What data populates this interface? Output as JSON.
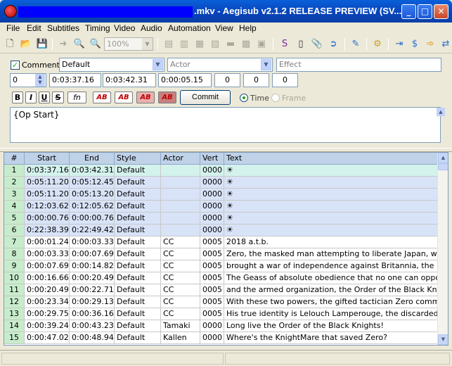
{
  "window": {
    "title": ".mkv - Aegisub v2.1.2 RELEASE PREVIEW (SV...",
    "minimize": "_",
    "maximize": "□",
    "close": "✕"
  },
  "menu": [
    "File",
    "Edit",
    "Subtitles",
    "Timing",
    "Video",
    "Audio",
    "Automation",
    "View",
    "Help"
  ],
  "toolbar": {
    "zoom": "100%",
    "icons": [
      "new-file-icon",
      "open-file-icon",
      "save-icon",
      "jump-icon",
      "zoom-in-icon",
      "zoom-out-icon",
      "zoom-select-icon",
      "clip-icon",
      "vector-clip-icon",
      "resample-icon",
      "styles-manager-icon",
      "attachments-icon",
      "find-icon",
      "replace-icon",
      "spell-check-icon",
      "properties-icon",
      "fonts-collector-icon",
      "translation-assistant-icon",
      "automation-icon",
      "timing-processor-icon",
      "kanji-timer-icon",
      "options-icon"
    ]
  },
  "editbox": {
    "comment_checked": true,
    "comment_label": "Comment",
    "style": "Default",
    "actor_placeholder": "Actor",
    "effect_placeholder": "Effect",
    "layer": "0",
    "start_time": "0:03:37.16",
    "end_time": "0:03:42.31",
    "duration": "0:00:05.15",
    "margin_l": "0",
    "margin_r": "0",
    "margin_v": "0",
    "bold": "B",
    "italic": "I",
    "underline": "U",
    "strikeout": "S",
    "font": "fn",
    "color1": "AB",
    "color2": "AB",
    "color3": "AB",
    "color4": "AB",
    "commit": "Commit",
    "time_label": "Time",
    "frame_label": "Frame",
    "time_mode": "Time",
    "text": "{Op Start}"
  },
  "grid": {
    "columns": [
      "#",
      "Start",
      "End",
      "Style",
      "Actor",
      "Vert",
      "Text"
    ],
    "rows": [
      {
        "n": "1",
        "start": "0:03:37.16",
        "end": "0:03:42.31",
        "style": "Default",
        "actor": "",
        "vert": "0000",
        "text": "☀",
        "state": "active"
      },
      {
        "n": "2",
        "start": "0:05:11.20",
        "end": "0:05:12.45",
        "style": "Default",
        "actor": "",
        "vert": "0000",
        "text": "☀",
        "state": "comment"
      },
      {
        "n": "3",
        "start": "0:05:11.20",
        "end": "0:05:13.20",
        "style": "Default",
        "actor": "",
        "vert": "0000",
        "text": "☀",
        "state": "comment"
      },
      {
        "n": "4",
        "start": "0:12:03.62",
        "end": "0:12:05.62",
        "style": "Default",
        "actor": "",
        "vert": "0000",
        "text": "☀",
        "state": "comment"
      },
      {
        "n": "5",
        "start": "0:00:00.76",
        "end": "0:00:00.76",
        "style": "Default",
        "actor": "",
        "vert": "0000",
        "text": "☀",
        "state": "comment"
      },
      {
        "n": "6",
        "start": "0:22:38.39",
        "end": "0:22:49.42",
        "style": "Default",
        "actor": "",
        "vert": "0000",
        "text": "☀",
        "state": "comment"
      },
      {
        "n": "7",
        "start": "0:00:01.24",
        "end": "0:00:03.33",
        "style": "Default",
        "actor": "CC",
        "vert": "0005",
        "text": "2018 a.t.b.",
        "state": "normal"
      },
      {
        "n": "8",
        "start": "0:00:03.33",
        "end": "0:00:07.69",
        "style": "Default",
        "actor": "CC",
        "vert": "0005",
        "text": "Zero, the masked man attempting to liberate Japan, which is n",
        "state": "normal"
      },
      {
        "n": "9",
        "start": "0:00:07.69",
        "end": "0:00:14.82",
        "style": "Default",
        "actor": "CC",
        "vert": "0005",
        "text": "brought a war of independence against Britannia, the Holy Em",
        "state": "normal"
      },
      {
        "n": "10",
        "start": "0:00:16.66",
        "end": "0:00:20.49",
        "style": "Default",
        "actor": "CC",
        "vert": "0005",
        "text": "The Geass of absolute obedience that no one can oppose,",
        "state": "normal"
      },
      {
        "n": "11",
        "start": "0:00:20.49",
        "end": "0:00:22.71",
        "style": "Default",
        "actor": "CC",
        "vert": "0005",
        "text": "and the armed organization, the Order of the Black Knights.",
        "state": "normal"
      },
      {
        "n": "12",
        "start": "0:00:23.34",
        "end": "0:00:29.13",
        "style": "Default",
        "actor": "CC",
        "vert": "0005",
        "text": "With these two powers, the gifted tactician Zero commences h",
        "state": "normal"
      },
      {
        "n": "13",
        "start": "0:00:29.75",
        "end": "0:00:36.16",
        "style": "Default",
        "actor": "CC",
        "vert": "0005",
        "text": "His true identity is Lelouch Lamperouge, the discarded prince c",
        "state": "normal"
      },
      {
        "n": "14",
        "start": "0:00:39.24",
        "end": "0:00:43.23",
        "style": "Default",
        "actor": "Tamaki",
        "vert": "0000",
        "text": "Long live the Order of the Black Knights!",
        "state": "normal"
      },
      {
        "n": "15",
        "start": "0:00:47.02",
        "end": "0:00:48.94",
        "style": "Default",
        "actor": "Kallen",
        "vert": "0000",
        "text": "Where's the KnightMare that saved Zero?",
        "state": "normal"
      }
    ]
  }
}
